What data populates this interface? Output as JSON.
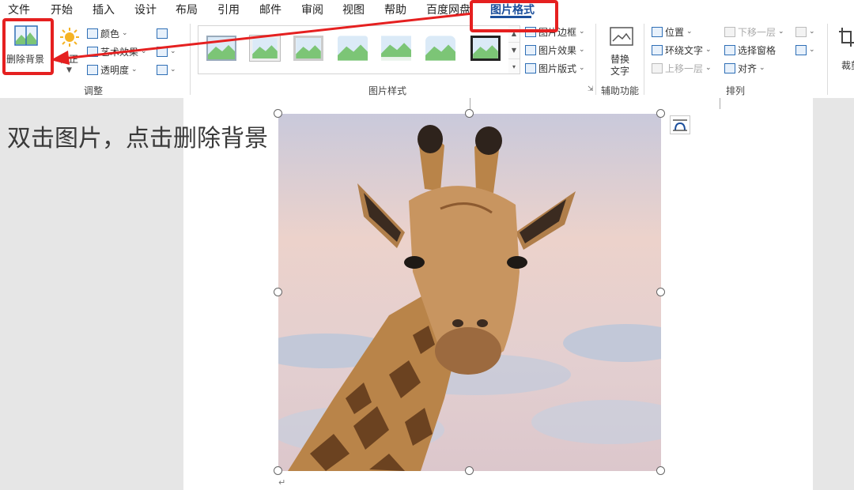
{
  "tabs": [
    "文件",
    "开始",
    "插入",
    "设计",
    "布局",
    "引用",
    "邮件",
    "审阅",
    "视图",
    "帮助",
    "百度网盘",
    "图片格式"
  ],
  "adjust": {
    "remove_bg": "删除背景",
    "correct": "校正",
    "color": "颜色",
    "artistic": "艺术效果",
    "transparency": "透明度",
    "group_label": "调整"
  },
  "styles": {
    "border": "图片边框",
    "effects": "图片效果",
    "layout": "图片版式",
    "group_label": "图片样式"
  },
  "access": {
    "alt_line1": "替换",
    "alt_line2": "文字",
    "group_label": "辅助功能"
  },
  "arrange": {
    "position": "位置",
    "wrap": "环绕文字",
    "bring_forward": "上移一层",
    "send_backward": "下移一层",
    "selection_pane": "选择窗格",
    "align": "对齐",
    "group_label": "排列"
  },
  "size": {
    "crop": "裁剪"
  },
  "document": {
    "instruction": "双击图片，点击删除背景",
    "paragraph_mark": "↵"
  },
  "colors": {
    "accent": "#1c4f9c",
    "highlight": "#e52020"
  }
}
